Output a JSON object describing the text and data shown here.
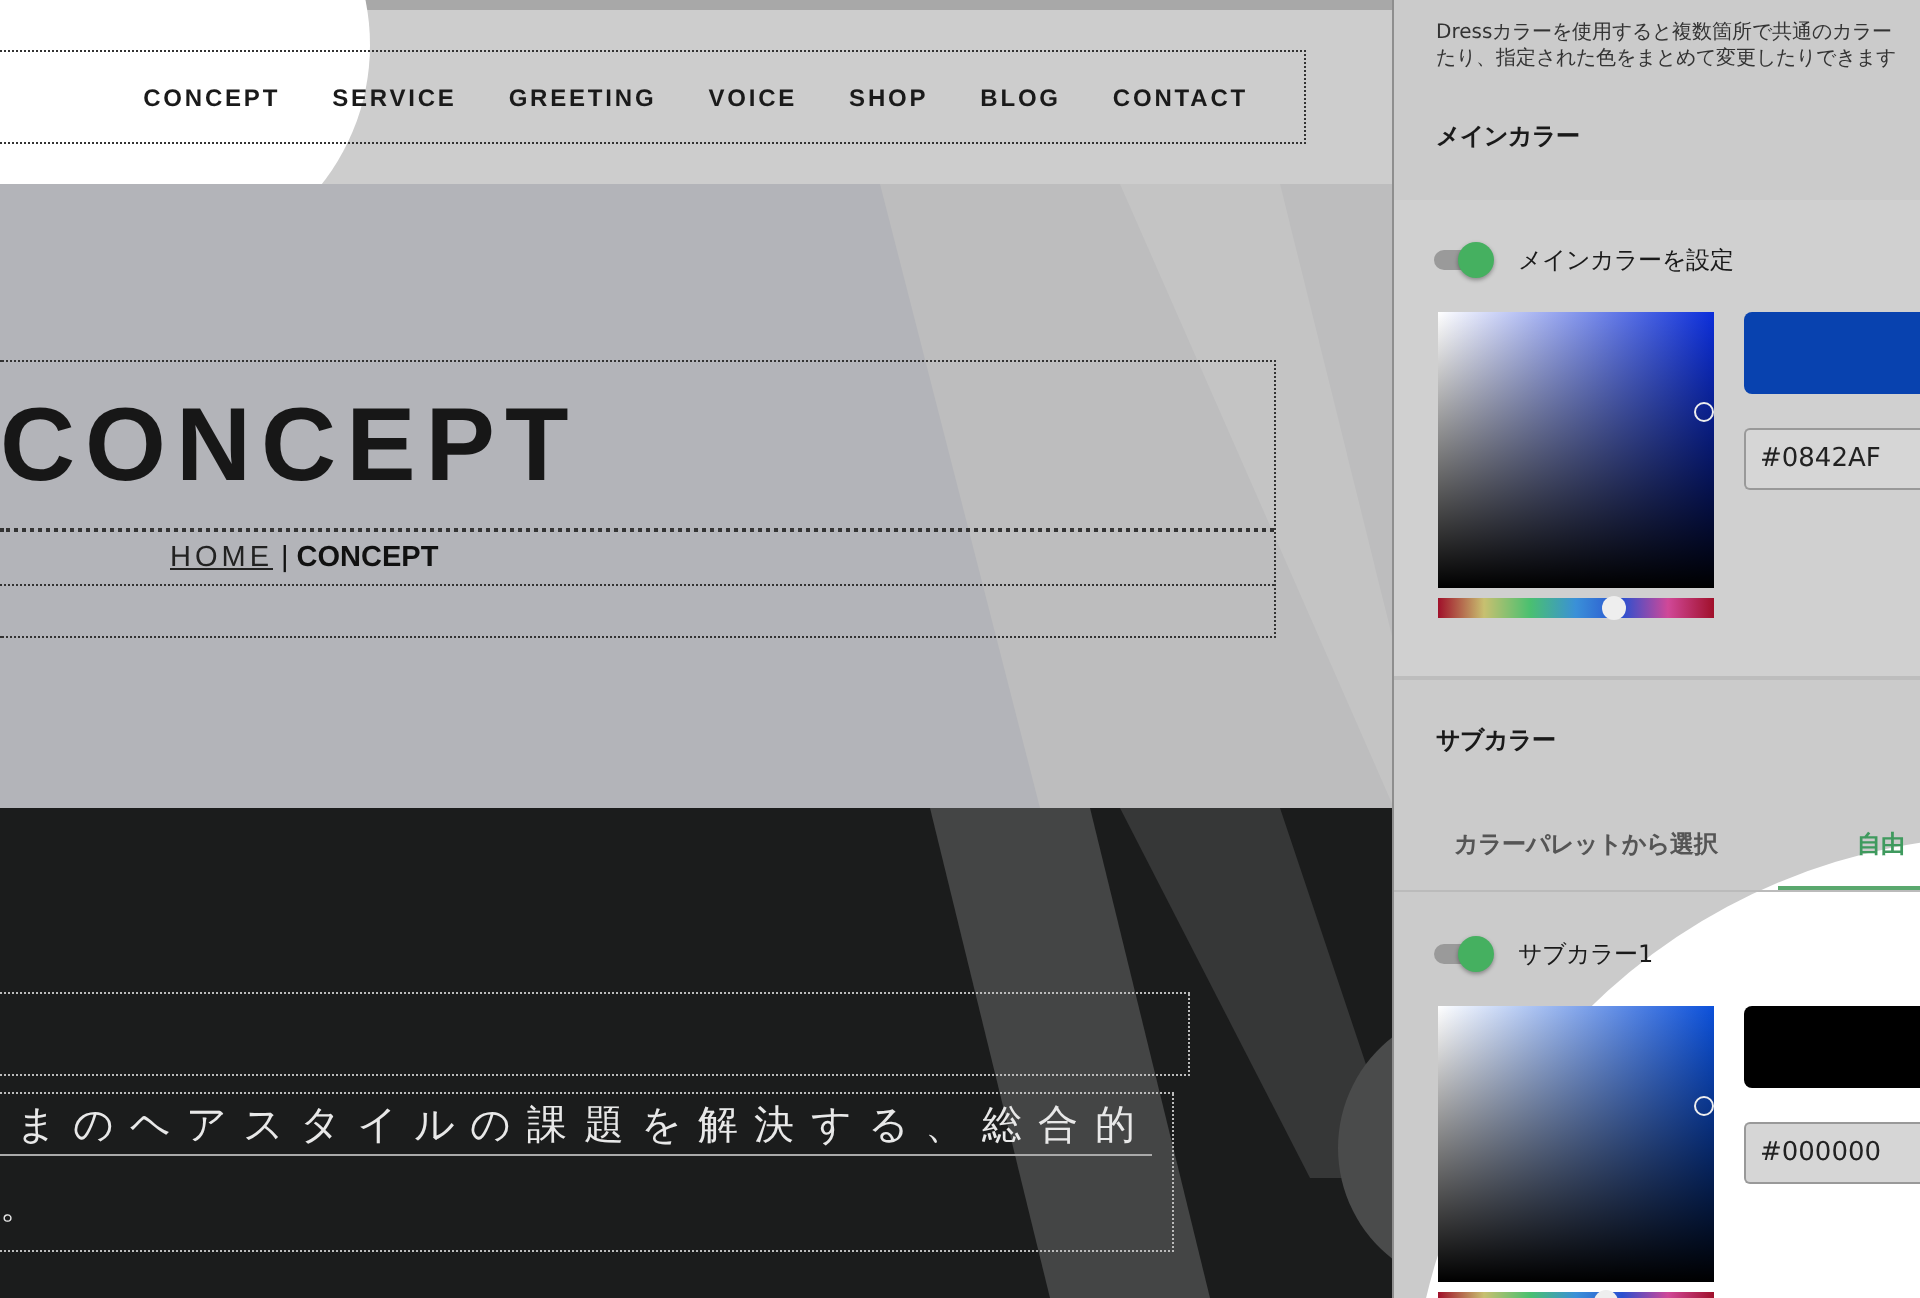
{
  "site": {
    "nav": [
      "CONCEPT",
      "SERVICE",
      "GREETING",
      "VOICE",
      "SHOP",
      "BLOG",
      "CONTACT"
    ],
    "hero": {
      "title": "CONCEPT",
      "breadcrumb": {
        "link": "HOME",
        "separator": "|",
        "current": "CONCEPT"
      }
    },
    "intro": {
      "lines": [
        "まのヘアスタイルの課題を解決する、総合的",
        "。"
      ]
    }
  },
  "panel": {
    "description": [
      "Dressカラーを使用すると複数箇所で共通のカラー",
      "たり、指定された色をまとめて変更したりできます"
    ],
    "main_color": {
      "heading": "メインカラー",
      "toggle": {
        "label": "メインカラーを設定",
        "on": true
      },
      "picker": {
        "value": "#0842AF",
        "level": 0.64
      }
    },
    "sub_color": {
      "heading": "サブカラー",
      "tabs": [
        {
          "label": "カラーパレットから選択",
          "selected": false
        },
        {
          "label": "自由",
          "selected": true
        }
      ],
      "toggle": {
        "label": "サブカラー1",
        "on": true
      },
      "picker": {
        "value": "#000000",
        "level": 0.61
      }
    }
  }
}
